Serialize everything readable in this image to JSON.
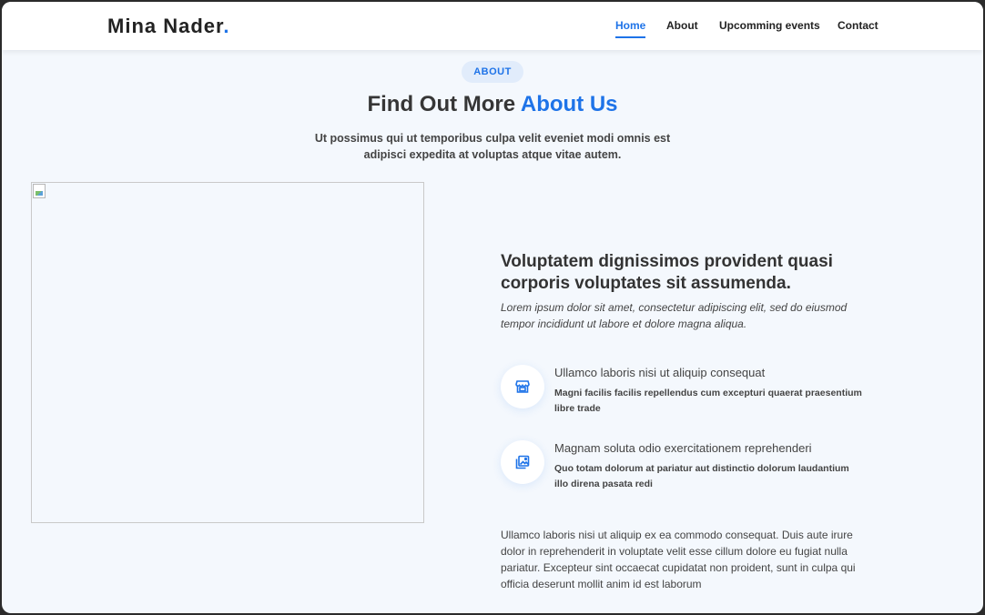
{
  "header": {
    "logo_text": "Mina Nader",
    "logo_dot": ".",
    "nav": [
      {
        "label": "Home",
        "active": true
      },
      {
        "label": "About",
        "active": false
      },
      {
        "label": "Upcomming events",
        "active": false
      },
      {
        "label": "Contact",
        "active": false
      }
    ]
  },
  "about": {
    "badge": "ABOUT",
    "title_prefix": "Find Out More ",
    "title_accent": "About Us",
    "subtitle": "Ut possimus qui ut temporibus culpa velit eveniet modi omnis est adipisci expedita at voluptas atque vitae autem.",
    "heading": "Voluptatem dignissimos provident quasi corporis voluptates sit assumenda.",
    "lead": "Lorem ipsum dolor sit amet, consectetur adipiscing elit, sed do eiusmod tempor incididunt ut labore et dolore magna aliqua.",
    "features": [
      {
        "icon": "store-icon",
        "title": "Ullamco laboris nisi ut aliquip consequat",
        "description": "Magni facilis facilis repellendus cum excepturi quaerat praesentium libre trade"
      },
      {
        "icon": "images-icon",
        "title": "Magnam soluta odio exercitationem reprehenderi",
        "description": "Quo totam dolorum at pariatur aut distinctio dolorum laudantium illo direna pasata redi"
      }
    ],
    "paragraph": "Ullamco laboris nisi ut aliquip ex ea commodo consequat. Duis aute irure dolor in reprehenderit in voluptate velit esse cillum dolore eu fugiat nulla pariatur. Excepteur sint occaecat cupidatat non proident, sunt in culpa qui officia deserunt mollit anim id est laborum"
  },
  "colors": {
    "accent": "#1e73e8",
    "background": "#f4f8fd",
    "text": "#333333"
  }
}
